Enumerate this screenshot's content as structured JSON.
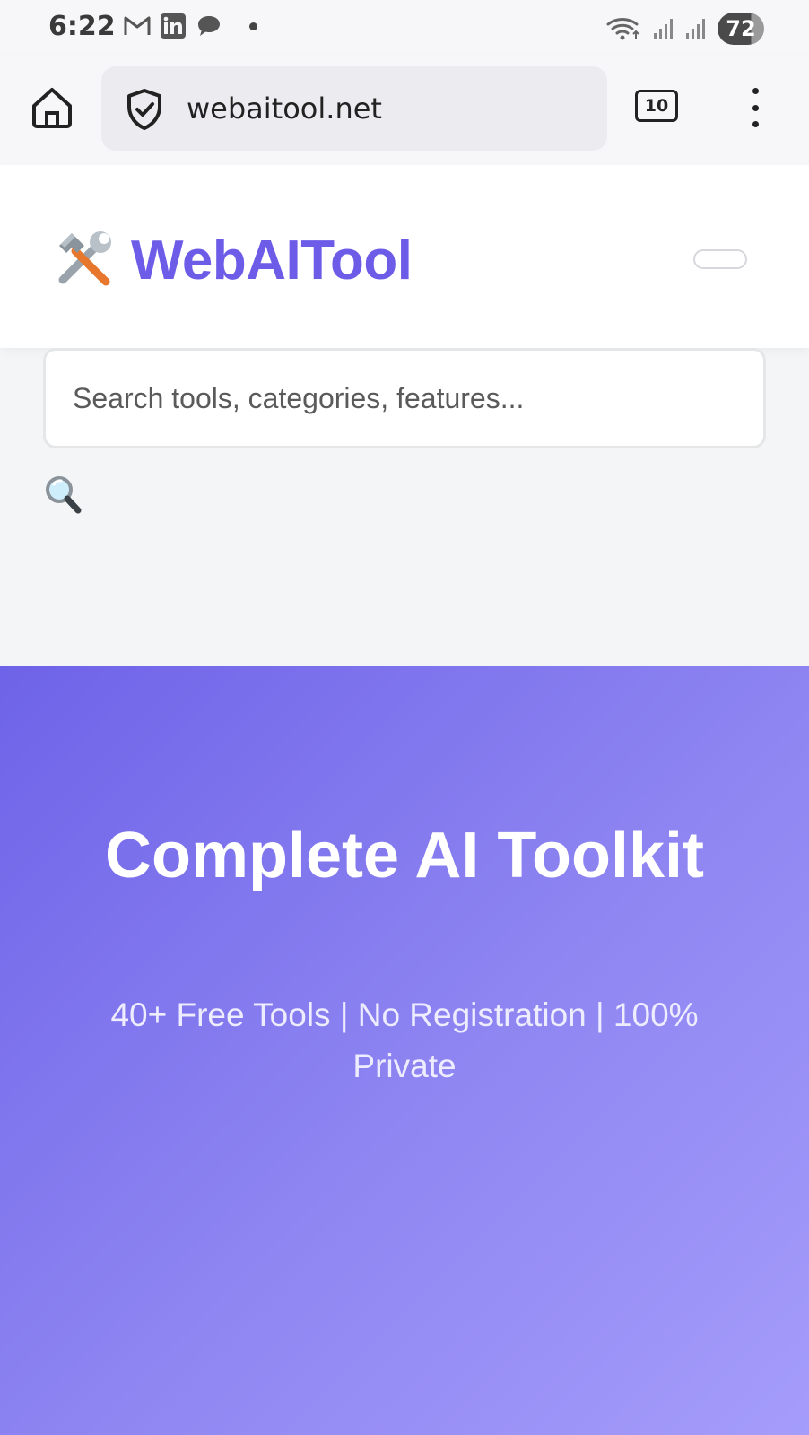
{
  "status_bar": {
    "time": "6:22",
    "battery": "72",
    "left_icons": [
      "gmail-icon",
      "linkedin-icon",
      "chat-icon"
    ],
    "right_icons": [
      "wifi-icon",
      "signal-icon",
      "signal-icon"
    ]
  },
  "browser": {
    "url": "webaitool.net",
    "tab_count": "10"
  },
  "header": {
    "logo_emoji": "🛠️",
    "brand": "WebAITool"
  },
  "search": {
    "placeholder": "Search tools, categories, features...",
    "icon_emoji": "🔍"
  },
  "hero": {
    "title": "Complete AI Toolkit",
    "subtitle": "40+ Free Tools | No Registration | 100% Private"
  },
  "colors": {
    "brand": "#6c5ce7",
    "hero_start": "#6e63e8",
    "hero_end": "#a59cfb"
  }
}
